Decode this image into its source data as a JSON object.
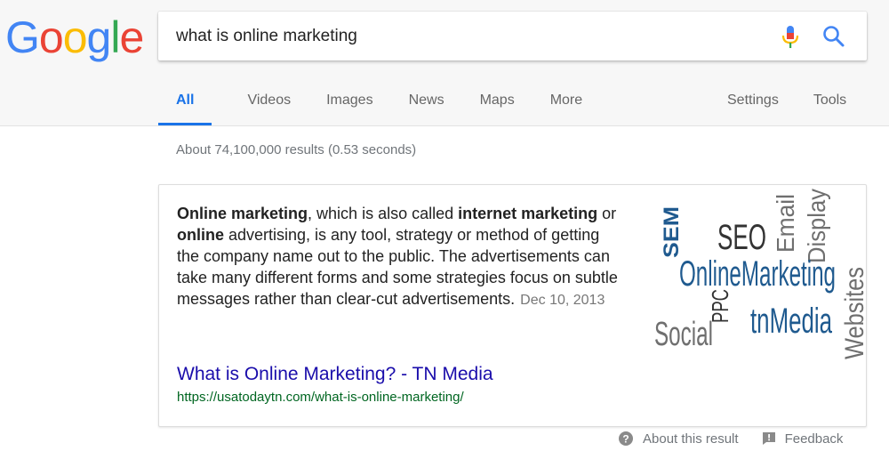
{
  "logo": {
    "letters": [
      "G",
      "o",
      "o",
      "g",
      "l",
      "e"
    ],
    "colors": [
      "#4285F4",
      "#EA4335",
      "#FBBC05",
      "#4285F4",
      "#34A853",
      "#EA4335"
    ]
  },
  "search": {
    "value": "what is online marketing"
  },
  "tabs": [
    {
      "label": "All",
      "active": true
    },
    {
      "label": "Videos"
    },
    {
      "label": "Images"
    },
    {
      "label": "News"
    },
    {
      "label": "Maps"
    },
    {
      "label": "More"
    }
  ],
  "tools_tabs": [
    {
      "label": "Settings"
    },
    {
      "label": "Tools"
    }
  ],
  "stats": "About 74,100,000 results (0.53 seconds)",
  "featured": {
    "snippet_parts": {
      "b1": "Online marketing",
      "t1": ", which is also called ",
      "b2": "internet marketing",
      "t2": " or ",
      "b3": "online",
      "t3": " advertising, is any tool, strategy or method of getting the company name out to the public. The advertisements can take many different forms and some strategies focus on subtle messages rather than clear-cut advertisements."
    },
    "date": "Dec 10, 2013",
    "link_title": "What is Online Marketing? - TN Media",
    "url": "https://usatodaytn.com/what-is-online-marketing/",
    "word_cloud": {
      "words": [
        "SEM",
        "SEO",
        "Email",
        "Display",
        "OnlineMarketing",
        "PPC",
        "tnMedia",
        "Social",
        "Websites"
      ],
      "colors": {
        "blue": "#1f5a8f",
        "gray": "#6f6f6f",
        "dark": "#333333"
      }
    }
  },
  "footer": {
    "about": "About this result",
    "feedback": "Feedback"
  },
  "colors": {
    "link": "#1a0dab",
    "url": "#006621",
    "accent": "#1a73e8"
  }
}
